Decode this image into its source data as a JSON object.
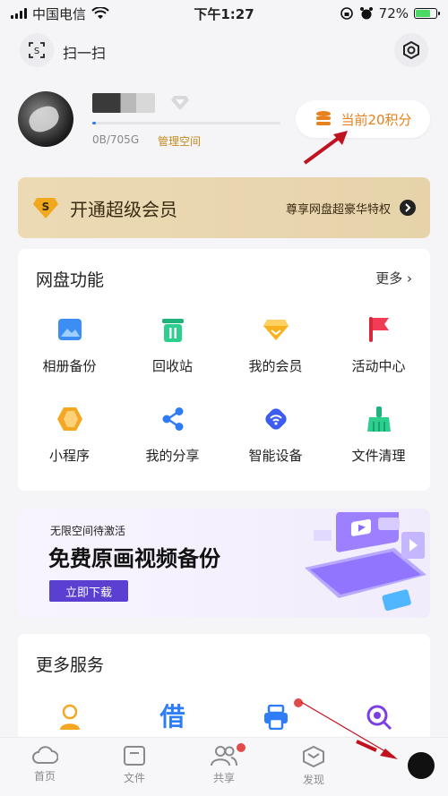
{
  "status_bar": {
    "carrier": "中国电信",
    "time": "下午1:27",
    "battery": "72%",
    "battery_level": 0.72
  },
  "header": {
    "scan_label": "扫一扫",
    "scan_icon": "scan-icon",
    "settings_icon": "gear-icon"
  },
  "profile": {
    "storage_used": "0B/705G",
    "storage_fraction": 0.02,
    "manage_label": "管理空间",
    "points_label": "当前20积分"
  },
  "vip_banner": {
    "title": "开通超级会员",
    "subtitle": "尊享网盘超豪华特权"
  },
  "features": {
    "title": "网盘功能",
    "more": "更多 ›",
    "items": [
      {
        "label": "相册备份",
        "icon": "photo-album-icon"
      },
      {
        "label": "回收站",
        "icon": "trash-icon"
      },
      {
        "label": "我的会员",
        "icon": "vip-diamond-icon"
      },
      {
        "label": "活动中心",
        "icon": "flag-icon"
      },
      {
        "label": "小程序",
        "icon": "mini-program-icon"
      },
      {
        "label": "我的分享",
        "icon": "share-icon"
      },
      {
        "label": "智能设备",
        "icon": "smart-device-icon"
      },
      {
        "label": "文件清理",
        "icon": "broom-icon"
      }
    ]
  },
  "promo": {
    "small": "无限空间待激活",
    "title": "免费原画视频备份",
    "button": "立即下载"
  },
  "services": {
    "title": "更多服务",
    "items": [
      {
        "icon": "person-service-icon"
      },
      {
        "icon": "borrow-icon",
        "text": "借"
      },
      {
        "icon": "printer-icon"
      },
      {
        "icon": "search-scan-icon"
      }
    ]
  },
  "tabbar": {
    "items": [
      {
        "label": "首页",
        "icon": "cloud-icon"
      },
      {
        "label": "文件",
        "icon": "folder-icon"
      },
      {
        "label": "共享",
        "icon": "people-icon"
      },
      {
        "label": "发现",
        "icon": "cube-icon"
      }
    ]
  },
  "colors": {
    "accent": "#e8801e",
    "blue": "#2e7cf6",
    "promo_button": "#5a3fd1",
    "arrow": "#c1121f"
  }
}
